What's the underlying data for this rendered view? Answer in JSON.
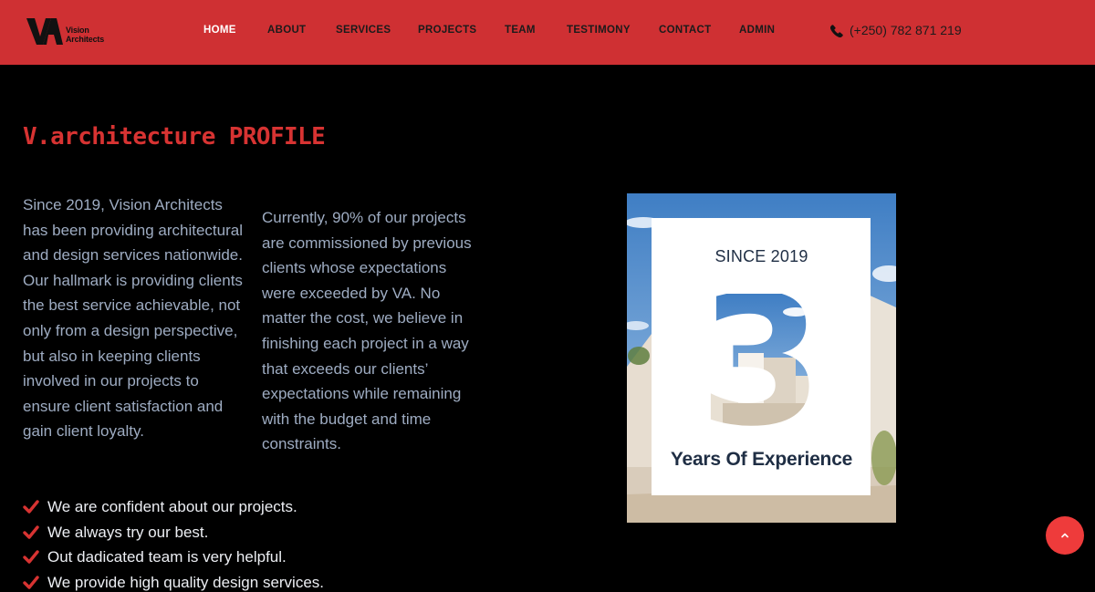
{
  "brand": {
    "logo_mark": "VA",
    "line1": "Vision",
    "line2": "Architects"
  },
  "nav": {
    "items": [
      {
        "label": "HOME",
        "active": true
      },
      {
        "label": "ABOUT",
        "active": false
      },
      {
        "label": "SERVICES",
        "active": false
      },
      {
        "label": "PROJECTS",
        "active": false
      },
      {
        "label": "TEAM",
        "active": false
      },
      {
        "label": "TESTIMONY",
        "active": false
      },
      {
        "label": "CONTACT",
        "active": false
      },
      {
        "label": "ADMIN",
        "active": false
      }
    ],
    "phone": "(+250) 782 871 219",
    "phone_icon": "phone-icon"
  },
  "profile": {
    "title": "V.architecture PROFILE",
    "para1": "Since 2019, Vision Architects has been providing architectural and design services nationwide. Our hallmark is providing clients the best service achievable, not only from a design perspective, but also in keeping clients involved in our projects to ensure client satisfaction and gain client loyalty.",
    "para2": "Currently, 90% of our projects are commissioned by previous clients whose expectations were exceeded by VA. No matter the cost, we believe in finishing each project in a way that exceeds our clients’ expectations while remaining with the budget and time constraints.",
    "checklist": [
      "We are confident about our projects.",
      "We always try our best.",
      "Out dadicated team is very helpful.",
      "We provide high quality design services."
    ],
    "check_icon": "check-icon"
  },
  "experience": {
    "since": "SINCE 2019",
    "number": "3",
    "label": "Years Of Experience"
  },
  "colors": {
    "navbar_bg": "#cf3033",
    "accent_red": "#d73332",
    "body_bg": "#000000",
    "paragraph_text": "#9eacc2",
    "card_text": "#1f2e44",
    "scroll_button": "#ee3b3b"
  },
  "scroll_top": {
    "icon": "chevron-up-icon"
  }
}
